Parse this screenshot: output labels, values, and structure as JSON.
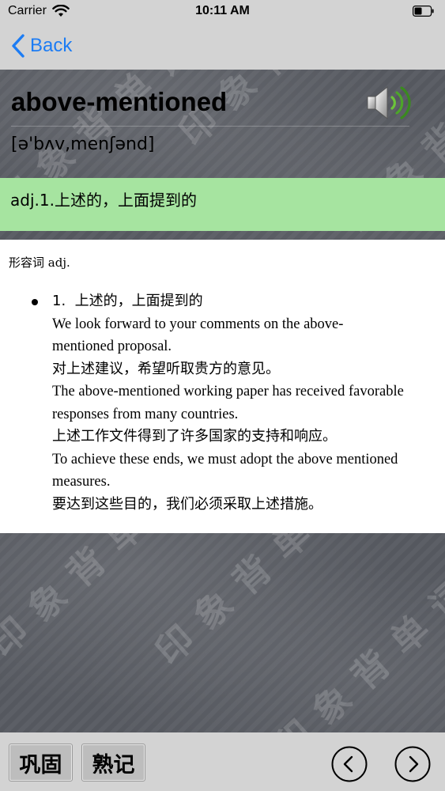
{
  "status": {
    "carrier": "Carrier",
    "time": "10:11 AM"
  },
  "nav": {
    "back_label": "Back"
  },
  "word": {
    "headword": "above-mentioned",
    "phonetic": "[ə'bʌv,menʃənd]",
    "short_definition": "adj.1.上述的，上面提到的"
  },
  "detail": {
    "part_of_speech": "形容词 adj.",
    "sense": {
      "number": "1.",
      "meaning": "上述的，上面提到的",
      "examples": [
        {
          "en": "We look forward to your comments on the above-mentioned proposal.",
          "zh": "对上述建议，希望听取贵方的意见。"
        },
        {
          "en": "The above-mentioned working paper has received favorable responses from many countries.",
          "zh": "上述工作文件得到了许多国家的支持和响应。"
        },
        {
          "en": "To achieve these ends, we must adopt the above mentioned measures.",
          "zh": "要达到这些目的，我们必须采取上述措施。"
        }
      ]
    }
  },
  "background_watermark": "印象背单词",
  "toolbar": {
    "review_label": "巩固",
    "known_label": "熟记"
  },
  "icons": {
    "wifi": "wifi-icon",
    "battery": "battery-icon",
    "back": "chevron-left-icon",
    "speaker": "speaker-icon",
    "prev": "chevron-left-circle-icon",
    "next": "chevron-right-circle-icon"
  },
  "colors": {
    "accent": "#1c7cf4",
    "definition_band": "#a6e4a0",
    "chrome": "#d3d3d3",
    "chalkboard": "#585b62"
  }
}
